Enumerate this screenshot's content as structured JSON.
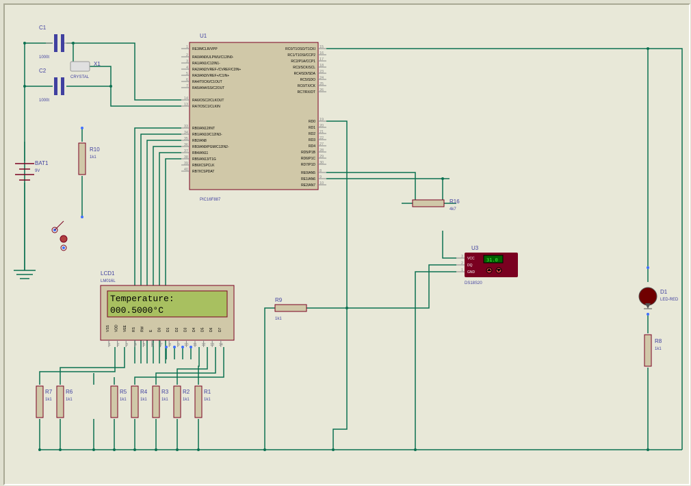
{
  "components": {
    "c1": {
      "ref": "C1",
      "value": "1000t"
    },
    "c2": {
      "ref": "C2",
      "value": "1000t"
    },
    "x1": {
      "ref": "X1",
      "value": "CRYSTAL"
    },
    "u1": {
      "ref": "U1",
      "part": "PIC16F887"
    },
    "u3": {
      "ref": "U3",
      "part": "DS18S20"
    },
    "bat1": {
      "ref": "BAT1",
      "value": "9V"
    },
    "r1": {
      "ref": "R1",
      "value": "1k1"
    },
    "r2": {
      "ref": "R2",
      "value": "1k1"
    },
    "r3": {
      "ref": "R3",
      "value": "1k1"
    },
    "r4": {
      "ref": "R4",
      "value": "1k1"
    },
    "r5": {
      "ref": "R5",
      "value": "1k1"
    },
    "r6": {
      "ref": "R6",
      "value": "1k1"
    },
    "r7": {
      "ref": "R7",
      "value": "1k1"
    },
    "r8": {
      "ref": "R8",
      "value": "1k1"
    },
    "r9": {
      "ref": "R9",
      "value": "1k1"
    },
    "r10": {
      "ref": "R10",
      "value": "1k1"
    },
    "r16": {
      "ref": "R16",
      "value": "4k7"
    },
    "d1": {
      "ref": "D1",
      "value": "LED-RED"
    },
    "lcd1": {
      "ref": "LCD1",
      "part": "LM016L"
    }
  },
  "chart_data": {
    "type": "table",
    "description": "Proteus schematic: PIC16F887 microcontroller driving an LM016L LCD showing temperature read from a DS18S20 sensor, with an LED indicator.",
    "lcd_display_lines": [
      " Temperature:",
      "  000.5000°C"
    ],
    "sensor_reading": "31.0",
    "u1_left_pins": [
      {
        "num": "1",
        "label": "RE3/MCLR/VPP"
      },
      {
        "num": "2",
        "label": "RA0/AN0/ULPWU/C12IN0-"
      },
      {
        "num": "3",
        "label": "RA1/AN1/C12IN1-"
      },
      {
        "num": "4",
        "label": "RA2/AN2/VREF-/CVREF/C2IN+"
      },
      {
        "num": "5",
        "label": "RA3/AN3/VREF+/C1IN+"
      },
      {
        "num": "6",
        "label": "RA4/T0CKI/C1OUT"
      },
      {
        "num": "7",
        "label": "RA5/AN4/SS/C2OUT"
      },
      {
        "num": "14",
        "label": "RA6/OSC2/CLKOUT"
      },
      {
        "num": "13",
        "label": "RA7/OSC1/CLKIN"
      },
      {
        "num": "33",
        "label": "RB0/AN12/INT"
      },
      {
        "num": "34",
        "label": "RB1/AN10/C12IN3-"
      },
      {
        "num": "35",
        "label": "RB2/AN8"
      },
      {
        "num": "36",
        "label": "RB3/AN9/PGM/C12IN2-"
      },
      {
        "num": "37",
        "label": "RB4/AN11"
      },
      {
        "num": "38",
        "label": "RB5/AN13/T1G"
      },
      {
        "num": "39",
        "label": "RB6/ICSPCLK"
      },
      {
        "num": "40",
        "label": "RB7/ICSPDAT"
      }
    ],
    "u1_right_pins": [
      {
        "num": "15",
        "label": "RC0/T1OSO/T1CKI"
      },
      {
        "num": "16",
        "label": "RC1/T1OSI/CCP2"
      },
      {
        "num": "17",
        "label": "RC2/P1A/CCP1"
      },
      {
        "num": "18",
        "label": "RC3/SCK/SCL"
      },
      {
        "num": "23",
        "label": "RC4/SDI/SDA"
      },
      {
        "num": "24",
        "label": "RC5/SDO"
      },
      {
        "num": "25",
        "label": "RC6/TX/CK"
      },
      {
        "num": "26",
        "label": "RC7/RX/DT"
      },
      {
        "num": "19",
        "label": "RD0"
      },
      {
        "num": "20",
        "label": "RD1"
      },
      {
        "num": "21",
        "label": "RD2"
      },
      {
        "num": "22",
        "label": "RD3"
      },
      {
        "num": "27",
        "label": "RD4"
      },
      {
        "num": "28",
        "label": "RD5/P1B"
      },
      {
        "num": "29",
        "label": "RD6/P1C"
      },
      {
        "num": "30",
        "label": "RD7/P1D"
      },
      {
        "num": "8",
        "label": "RE0/AN5"
      },
      {
        "num": "9",
        "label": "RE1/AN6"
      },
      {
        "num": "10",
        "label": "RE2/AN7"
      }
    ],
    "u3_pins": [
      {
        "num": "3",
        "label": "VCC"
      },
      {
        "num": "2",
        "label": "DQ"
      },
      {
        "num": "1",
        "label": "GND"
      }
    ],
    "lcd_pins": [
      "VSS",
      "VDD",
      "VEE",
      "RS",
      "RW",
      "E",
      "D0",
      "D1",
      "D2",
      "D3",
      "D4",
      "D5",
      "D6",
      "D7"
    ]
  }
}
